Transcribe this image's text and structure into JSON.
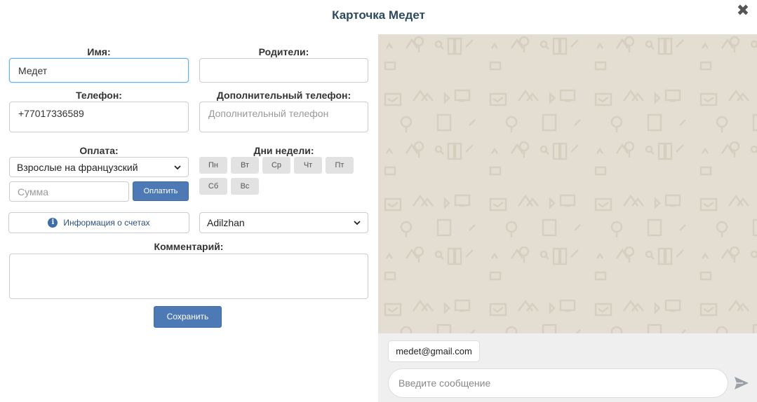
{
  "header": {
    "title": "Карточка Медет",
    "close_icon": "close-icon"
  },
  "form": {
    "name": {
      "label": "Имя:",
      "value": "Медет"
    },
    "parents": {
      "label": "Родители:",
      "value": "",
      "placeholder": ""
    },
    "phone": {
      "label": "Телефон:",
      "value": "+77017336589"
    },
    "extra_phone": {
      "label": "Дополнительный телефон:",
      "value": "",
      "placeholder": "Дополнительный телефон"
    },
    "payment": {
      "label": "Оплата:",
      "selected": "Взрослые на французский",
      "amount_placeholder": "Сумма",
      "pay_button": "Оплатить"
    },
    "weekdays": {
      "label": "Дни недели:",
      "days": [
        "Пн",
        "Вт",
        "Ср",
        "Чт",
        "Пт",
        "Сб",
        "Вс"
      ]
    },
    "invoices_button": "Информация о счетах",
    "teacher": {
      "selected": "Adilzhan"
    },
    "comment": {
      "label": "Комментарий:",
      "value": ""
    },
    "save_button": "Сохранить"
  },
  "chat": {
    "email_chip": "medet@gmail.com",
    "message_placeholder": "Введите сообщение",
    "send_icon": "send-icon",
    "background_color": "#e3ddd2"
  },
  "colors": {
    "primary": "#4d7ab5",
    "title": "#2c4a5e",
    "focus_border": "#66afe9"
  }
}
